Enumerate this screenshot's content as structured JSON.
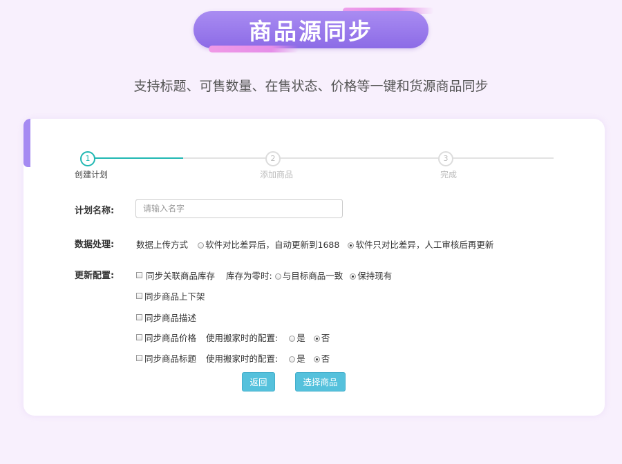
{
  "banner": {
    "title": "商品源同步"
  },
  "subtitle": "支持标题、可售数量、在售状态、价格等一键和货源商品同步",
  "steps": [
    {
      "number": "1",
      "label": "创建计划"
    },
    {
      "number": "2",
      "label": "添加商品"
    },
    {
      "number": "3",
      "label": "完成"
    }
  ],
  "form": {
    "plan_name": {
      "label": "计划名称:",
      "placeholder": "请输入名字",
      "value": ""
    },
    "data_processing": {
      "label": "数据处理:",
      "prefix": "数据上传方式",
      "option1": "软件对比差异后，自动更新到1688",
      "option2": "软件只对比差异，人工审核后再更新",
      "selected": 2
    },
    "update_config": {
      "label": "更新配置:",
      "stock_sync": "同步关联商品库存",
      "stock_zero_label": "库存为零时:",
      "stock_zero_option1": "与目标商品一致",
      "stock_zero_option2": "保持现有",
      "shelf_sync": "同步商品上下架",
      "desc_sync": "同步商品描述",
      "price_sync": "同步商品价格",
      "title_sync": "同步商品标题",
      "move_config_label": "使用搬家时的配置:",
      "yes": "是",
      "no": "否"
    }
  },
  "buttons": {
    "back": "返回",
    "select_products": "选择商品"
  },
  "colors": {
    "accent": "#8c6be6",
    "step_active": "#1fb7b2",
    "button": "#55c1dc"
  }
}
